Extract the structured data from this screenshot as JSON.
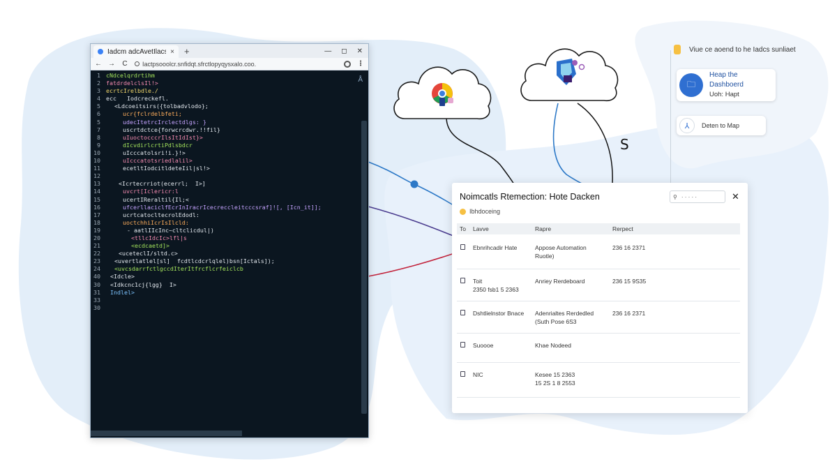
{
  "browser": {
    "tab_title": "Iadcm adcAvetIlacst",
    "tab_close": "×",
    "new_tab": "+",
    "window_controls": [
      "—",
      "◻",
      "✕"
    ],
    "nav": {
      "back": "←",
      "forward": "→",
      "reload": "C"
    },
    "url": "Iactpsooolcr.snfidqt.sfrctlopyqysxalo.coo.",
    "menu": "⋮"
  },
  "editor": {
    "side_mark": "Å",
    "lines": [
      {
        "n": "1",
        "indent": 0,
        "text": "cNdcelqrdrtihm",
        "color": "kw-green"
      },
      {
        "n": "2",
        "indent": 0,
        "text": "fatdrdelclsIl!>",
        "color": "kw-pink"
      },
      {
        "n": "3",
        "indent": 0,
        "text": "ecrtcIrelbdle./",
        "color": "kw-yellow"
      },
      {
        "n": "4",
        "indent": 0,
        "text": "ecc   Iodcreckefl.",
        "color": "kw-white"
      },
      {
        "n": "5",
        "indent": 2,
        "text": "<Ldcoeitsirs({tolbadvlodo};",
        "color": "kw-white"
      },
      {
        "n": "6",
        "indent": 4,
        "text": "ucr{fclrdelbfeti;",
        "color": "kw-orange"
      },
      {
        "n": "5",
        "indent": 4,
        "text": "udecItetrcIrclectdlgs: }",
        "color": "kw-purple"
      },
      {
        "n": "7",
        "indent": 4,
        "text": "uscrtdctce{forwcrcdwr.!!fil}",
        "color": "kw-white"
      },
      {
        "n": "8",
        "indent": 4,
        "text": "uIuoctocccrIlsItIdIst}>",
        "color": "kw-pink"
      },
      {
        "n": "9",
        "indent": 4,
        "text": "dIcvdirlcrtiPdlsbdcr",
        "color": "kw-green"
      },
      {
        "n": "10",
        "indent": 4,
        "text": "uIcccatolsri!i.}!>",
        "color": "kw-white"
      },
      {
        "n": "10",
        "indent": 4,
        "text": "uIcccatotsriedlalil>",
        "color": "kw-pink"
      },
      {
        "n": "11",
        "indent": 4,
        "text": "ecetltIodcitldeteIil|sl!>",
        "color": "kw-white"
      },
      {
        "n": "12",
        "indent": 0,
        "text": "",
        "color": "kw-white"
      },
      {
        "n": "13",
        "indent": 3,
        "text": "<Icrtecrriot(ecerrl;  I>]",
        "color": "kw-white"
      },
      {
        "n": "14",
        "indent": 4,
        "text": "uvcrt[Iclericr:l",
        "color": "kw-pink"
      },
      {
        "n": "15",
        "indent": 4,
        "text": "ucertIReraltil{Il;<",
        "color": "kw-white"
      },
      {
        "n": "16",
        "indent": 4,
        "text": "ufcerllaciclfEcrInIracrIcecreccleitcccsraf]![, [Icn_it]];",
        "color": "kw-purple"
      },
      {
        "n": "17",
        "indent": 4,
        "text": "ucrtcatocltecrolEdodl:",
        "color": "kw-white"
      },
      {
        "n": "18",
        "indent": 4,
        "text": "uoctchhiIcrIsIlcld:",
        "color": "kw-orange"
      },
      {
        "n": "19",
        "indent": 5,
        "text": "- aatlIIcInc~cltclicdul|)",
        "color": "kw-white"
      },
      {
        "n": "20",
        "indent": 6,
        "text": "<tllcIdcIc>lfl|s",
        "color": "kw-pink"
      },
      {
        "n": "21",
        "indent": 6,
        "text": "<ecdcaetd]>",
        "color": "kw-green"
      },
      {
        "n": "22",
        "indent": 3,
        "text": "<uceteclI/sltd.c>",
        "color": "kw-white"
      },
      {
        "n": "23",
        "indent": 2,
        "text": "<uvertlatlel[sl]  fcdtlcdcrlqlel)bsn[Ictals]);",
        "color": "kw-white"
      },
      {
        "n": "24",
        "indent": 2,
        "text": "<uvcsdarrfctlgccdIterItfrcflcrfeiclcb",
        "color": "kw-green"
      },
      {
        "n": "40",
        "indent": 1,
        "text": "<Idcle>",
        "color": "kw-white"
      },
      {
        "n": "30",
        "indent": 1,
        "text": "<Idkcnc1cj{lgg}  I>",
        "color": "kw-white"
      },
      {
        "n": "31",
        "indent": 1,
        "text": "Indlel>",
        "color": "kw-blue"
      },
      {
        "n": "33",
        "indent": 0,
        "text": "",
        "color": "kw-white"
      },
      {
        "n": "30",
        "indent": 0,
        "text": "",
        "color": "kw-white"
      }
    ]
  },
  "big_s": "S",
  "right_panel": {
    "top_note": "Viue ce aoend to he Iadcs sunliaet",
    "help_card": {
      "title": "Heap the Dashboerd",
      "subtitle": "Uoh: Hapt",
      "icon": "🗀"
    },
    "detect_card": {
      "label": "Deten to Map",
      "icon": "⅄"
    }
  },
  "dialog": {
    "title": "Noimcatls Rtemection: Hote Dacken",
    "search_placeholder": "I",
    "search_value": "· · · · ·",
    "close": "✕",
    "subtitle": "Ibhdoceing",
    "columns": [
      "To",
      "Lavve",
      "Rapre",
      "Rerpect"
    ],
    "rows": [
      {
        "lave": "Ebnrihcadir Hate",
        "rapre": "Appose Automation",
        "rapre2": "Ruotle)",
        "rerpect": "236 16 2371",
        "lave2": ""
      },
      {
        "lave": "Toit",
        "lave2": "2350 fsb1 5 2363",
        "rapre": "Anriey Rerdeboard",
        "rapre2": "",
        "rerpect": "236 15 9S35"
      },
      {
        "lave": "Dshtlielnstor Bnace",
        "rapre": "Adenrialtes Rerdedled",
        "rapre2": "(Suth Pose 6S3",
        "rerpect": "236 16 2371",
        "lave2": ""
      },
      {
        "lave": "Suoooe",
        "rapre": "Khae Nodeed",
        "rapre2": "",
        "rerpect": "",
        "lave2": ""
      },
      {
        "lave": "NIC",
        "rapre": "Kesee 15 2363",
        "rapre2": "15 2S 1 8 2553",
        "rerpect": "",
        "lave2": ""
      }
    ]
  },
  "colors": {
    "editor_bg": "#0b1620",
    "accent_blue": "#2f6fd1",
    "note_yellow": "#f6c043",
    "line_blue": "#2d79c7",
    "line_purple": "#4b3d8f",
    "line_red": "#c2243c"
  }
}
